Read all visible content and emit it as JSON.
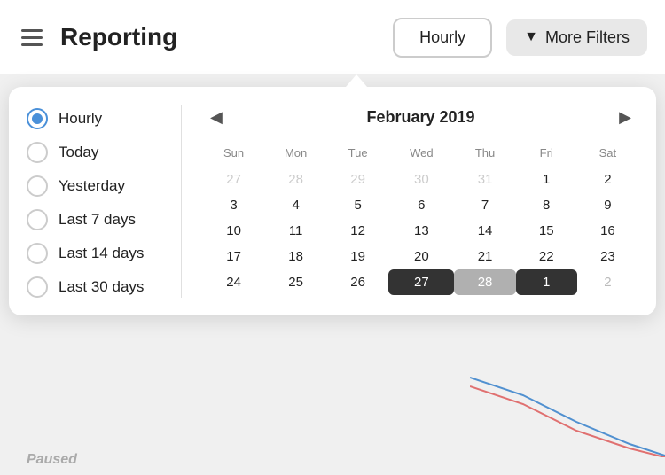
{
  "topbar": {
    "title": "Reporting",
    "hourly_btn": "Hourly",
    "more_filters_btn": "More Filters"
  },
  "dropdown": {
    "options": [
      {
        "id": "hourly",
        "label": "Hourly",
        "selected": true
      },
      {
        "id": "today",
        "label": "Today",
        "selected": false
      },
      {
        "id": "yesterday",
        "label": "Yesterday",
        "selected": false
      },
      {
        "id": "last7",
        "label": "Last 7 days",
        "selected": false
      },
      {
        "id": "last14",
        "label": "Last 14 days",
        "selected": false
      },
      {
        "id": "last30",
        "label": "Last 30 days",
        "selected": false
      }
    ],
    "calendar": {
      "month_year": "February 2019",
      "days_of_week": [
        "Sun",
        "Mon",
        "Tue",
        "Wed",
        "Thu",
        "Fri",
        "Sat"
      ],
      "weeks": [
        [
          {
            "day": "27",
            "type": "other-month"
          },
          {
            "day": "28",
            "type": "other-month"
          },
          {
            "day": "29",
            "type": "other-month"
          },
          {
            "day": "30",
            "type": "other-month"
          },
          {
            "day": "31",
            "type": "other-month"
          },
          {
            "day": "1",
            "type": "normal"
          },
          {
            "day": "2",
            "type": "normal"
          }
        ],
        [
          {
            "day": "3",
            "type": "normal"
          },
          {
            "day": "4",
            "type": "normal"
          },
          {
            "day": "5",
            "type": "normal"
          },
          {
            "day": "6",
            "type": "normal"
          },
          {
            "day": "7",
            "type": "normal"
          },
          {
            "day": "8",
            "type": "normal"
          },
          {
            "day": "9",
            "type": "normal"
          }
        ],
        [
          {
            "day": "10",
            "type": "normal"
          },
          {
            "day": "11",
            "type": "normal"
          },
          {
            "day": "12",
            "type": "normal"
          },
          {
            "day": "13",
            "type": "normal"
          },
          {
            "day": "14",
            "type": "normal"
          },
          {
            "day": "15",
            "type": "normal"
          },
          {
            "day": "16",
            "type": "normal"
          }
        ],
        [
          {
            "day": "17",
            "type": "normal"
          },
          {
            "day": "18",
            "type": "normal"
          },
          {
            "day": "19",
            "type": "normal"
          },
          {
            "day": "20",
            "type": "normal"
          },
          {
            "day": "21",
            "type": "normal"
          },
          {
            "day": "22",
            "type": "normal"
          },
          {
            "day": "23",
            "type": "normal"
          }
        ],
        [
          {
            "day": "24",
            "type": "normal"
          },
          {
            "day": "25",
            "type": "normal"
          },
          {
            "day": "26",
            "type": "normal"
          },
          {
            "day": "27",
            "type": "selected-dark"
          },
          {
            "day": "28",
            "type": "selected-gray"
          },
          {
            "day": "1",
            "type": "selected-dark"
          },
          {
            "day": "2",
            "type": "other-month-light"
          }
        ]
      ]
    }
  },
  "bottom": {
    "paused_label": "Paused"
  }
}
